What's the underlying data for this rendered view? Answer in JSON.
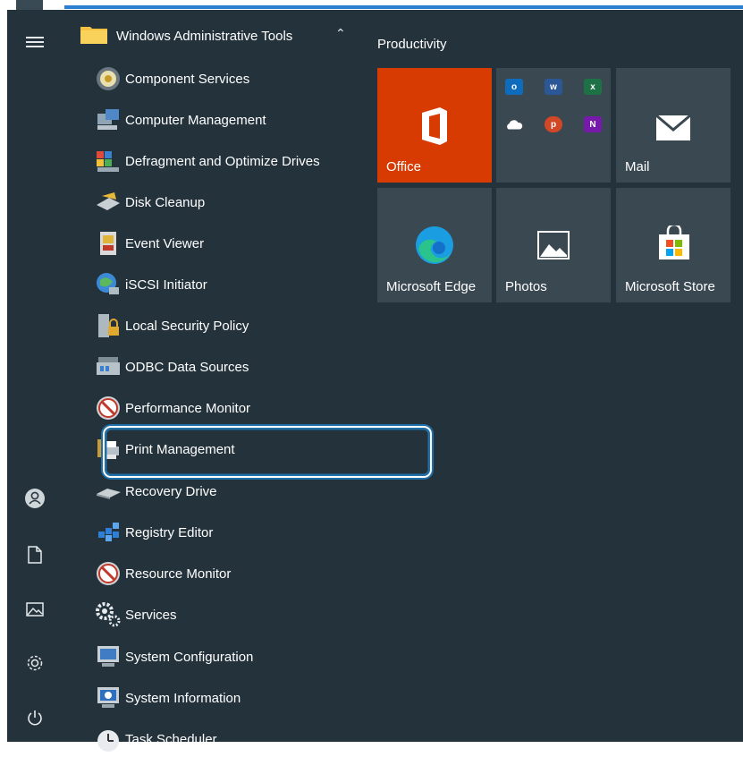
{
  "folder": {
    "label": "Windows Administrative Tools"
  },
  "apps": [
    {
      "label": "Component Services",
      "icon": "component-services-icon"
    },
    {
      "label": "Computer Management",
      "icon": "computer-management-icon"
    },
    {
      "label": "Defragment and Optimize Drives",
      "icon": "defragment-icon"
    },
    {
      "label": "Disk Cleanup",
      "icon": "disk-cleanup-icon"
    },
    {
      "label": "Event Viewer",
      "icon": "event-viewer-icon"
    },
    {
      "label": "iSCSI Initiator",
      "icon": "iscsi-icon"
    },
    {
      "label": "Local Security Policy",
      "icon": "security-policy-icon"
    },
    {
      "label": "ODBC Data Sources",
      "icon": "odbc-icon"
    },
    {
      "label": "Performance Monitor",
      "icon": "performance-monitor-icon"
    },
    {
      "label": "Print Management",
      "icon": "print-management-icon"
    },
    {
      "label": "Recovery Drive",
      "icon": "recovery-drive-icon"
    },
    {
      "label": "Registry Editor",
      "icon": "registry-editor-icon"
    },
    {
      "label": "Resource Monitor",
      "icon": "resource-monitor-icon"
    },
    {
      "label": "Services",
      "icon": "services-icon"
    },
    {
      "label": "System Configuration",
      "icon": "system-configuration-icon"
    },
    {
      "label": "System Information",
      "icon": "system-information-icon"
    },
    {
      "label": "Task Scheduler",
      "icon": "task-scheduler-icon"
    }
  ],
  "tiles": {
    "group_title": "Productivity",
    "office": "Office",
    "mail": "Mail",
    "edge": "Microsoft Edge",
    "photos": "Photos",
    "store": "Microsoft Store"
  },
  "colors": {
    "background": "#23323b",
    "tile": "#3a4852",
    "office": "#d83b01",
    "accent": "#2b7fd1"
  }
}
